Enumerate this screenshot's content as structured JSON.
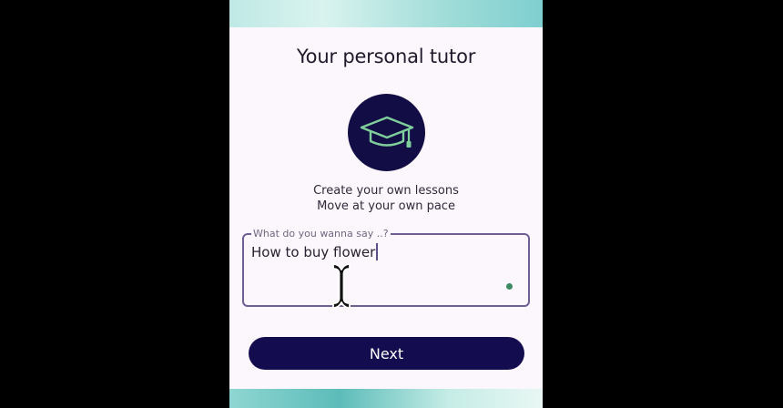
{
  "app": {
    "title": "Your personal tutor",
    "logo_icon": "graduation-cap-icon",
    "taglines": [
      "Create your own lessons",
      "Move at your own pace"
    ]
  },
  "input": {
    "label": "What do you wanna say ..?",
    "value": "How to buy flower"
  },
  "actions": {
    "next_label": "Next"
  },
  "colors": {
    "brand_navy": "#130d45",
    "accent_green": "#7fcf9b",
    "field_border": "#6f5f95",
    "status_dot": "#3c8a62",
    "background": "#fcf6fd"
  }
}
